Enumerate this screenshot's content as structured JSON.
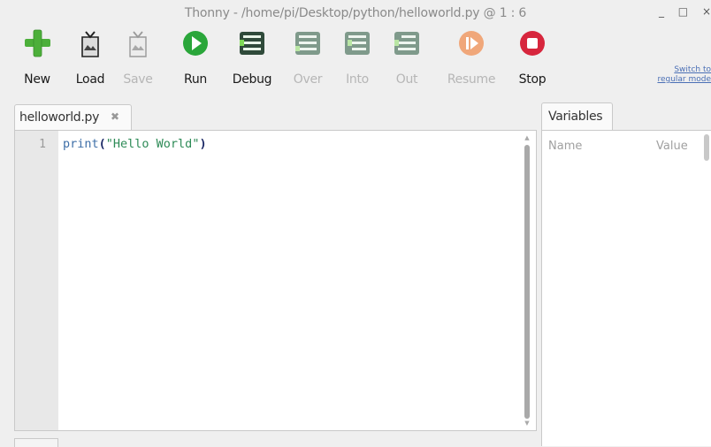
{
  "window": {
    "title": "Thonny  -  /home/pi/Desktop/python/helloworld.py  @  1 : 6",
    "minimize": "_",
    "maximize": "□",
    "close": "×"
  },
  "toolbar": {
    "new": "New",
    "load": "Load",
    "save": "Save",
    "run": "Run",
    "debug": "Debug",
    "over": "Over",
    "into": "Into",
    "out": "Out",
    "resume": "Resume",
    "stop": "Stop"
  },
  "switch_mode": {
    "line1": "Switch to",
    "line2": "regular mode"
  },
  "editor": {
    "tab_label": "helloworld.py",
    "tab_close": "✖",
    "line_number": "1",
    "code": {
      "fn": "print",
      "open": "(",
      "string": "\"Hello World\"",
      "close": ")"
    }
  },
  "variables": {
    "tab_label": "Variables",
    "col_name": "Name",
    "col_value": "Value"
  },
  "colors": {
    "new_plus": "#4caf3a",
    "run_green": "#2aa63a",
    "stop_red": "#d7263d",
    "resume_orange": "#f0a77a",
    "debug_dark": "#2f4a3a"
  }
}
